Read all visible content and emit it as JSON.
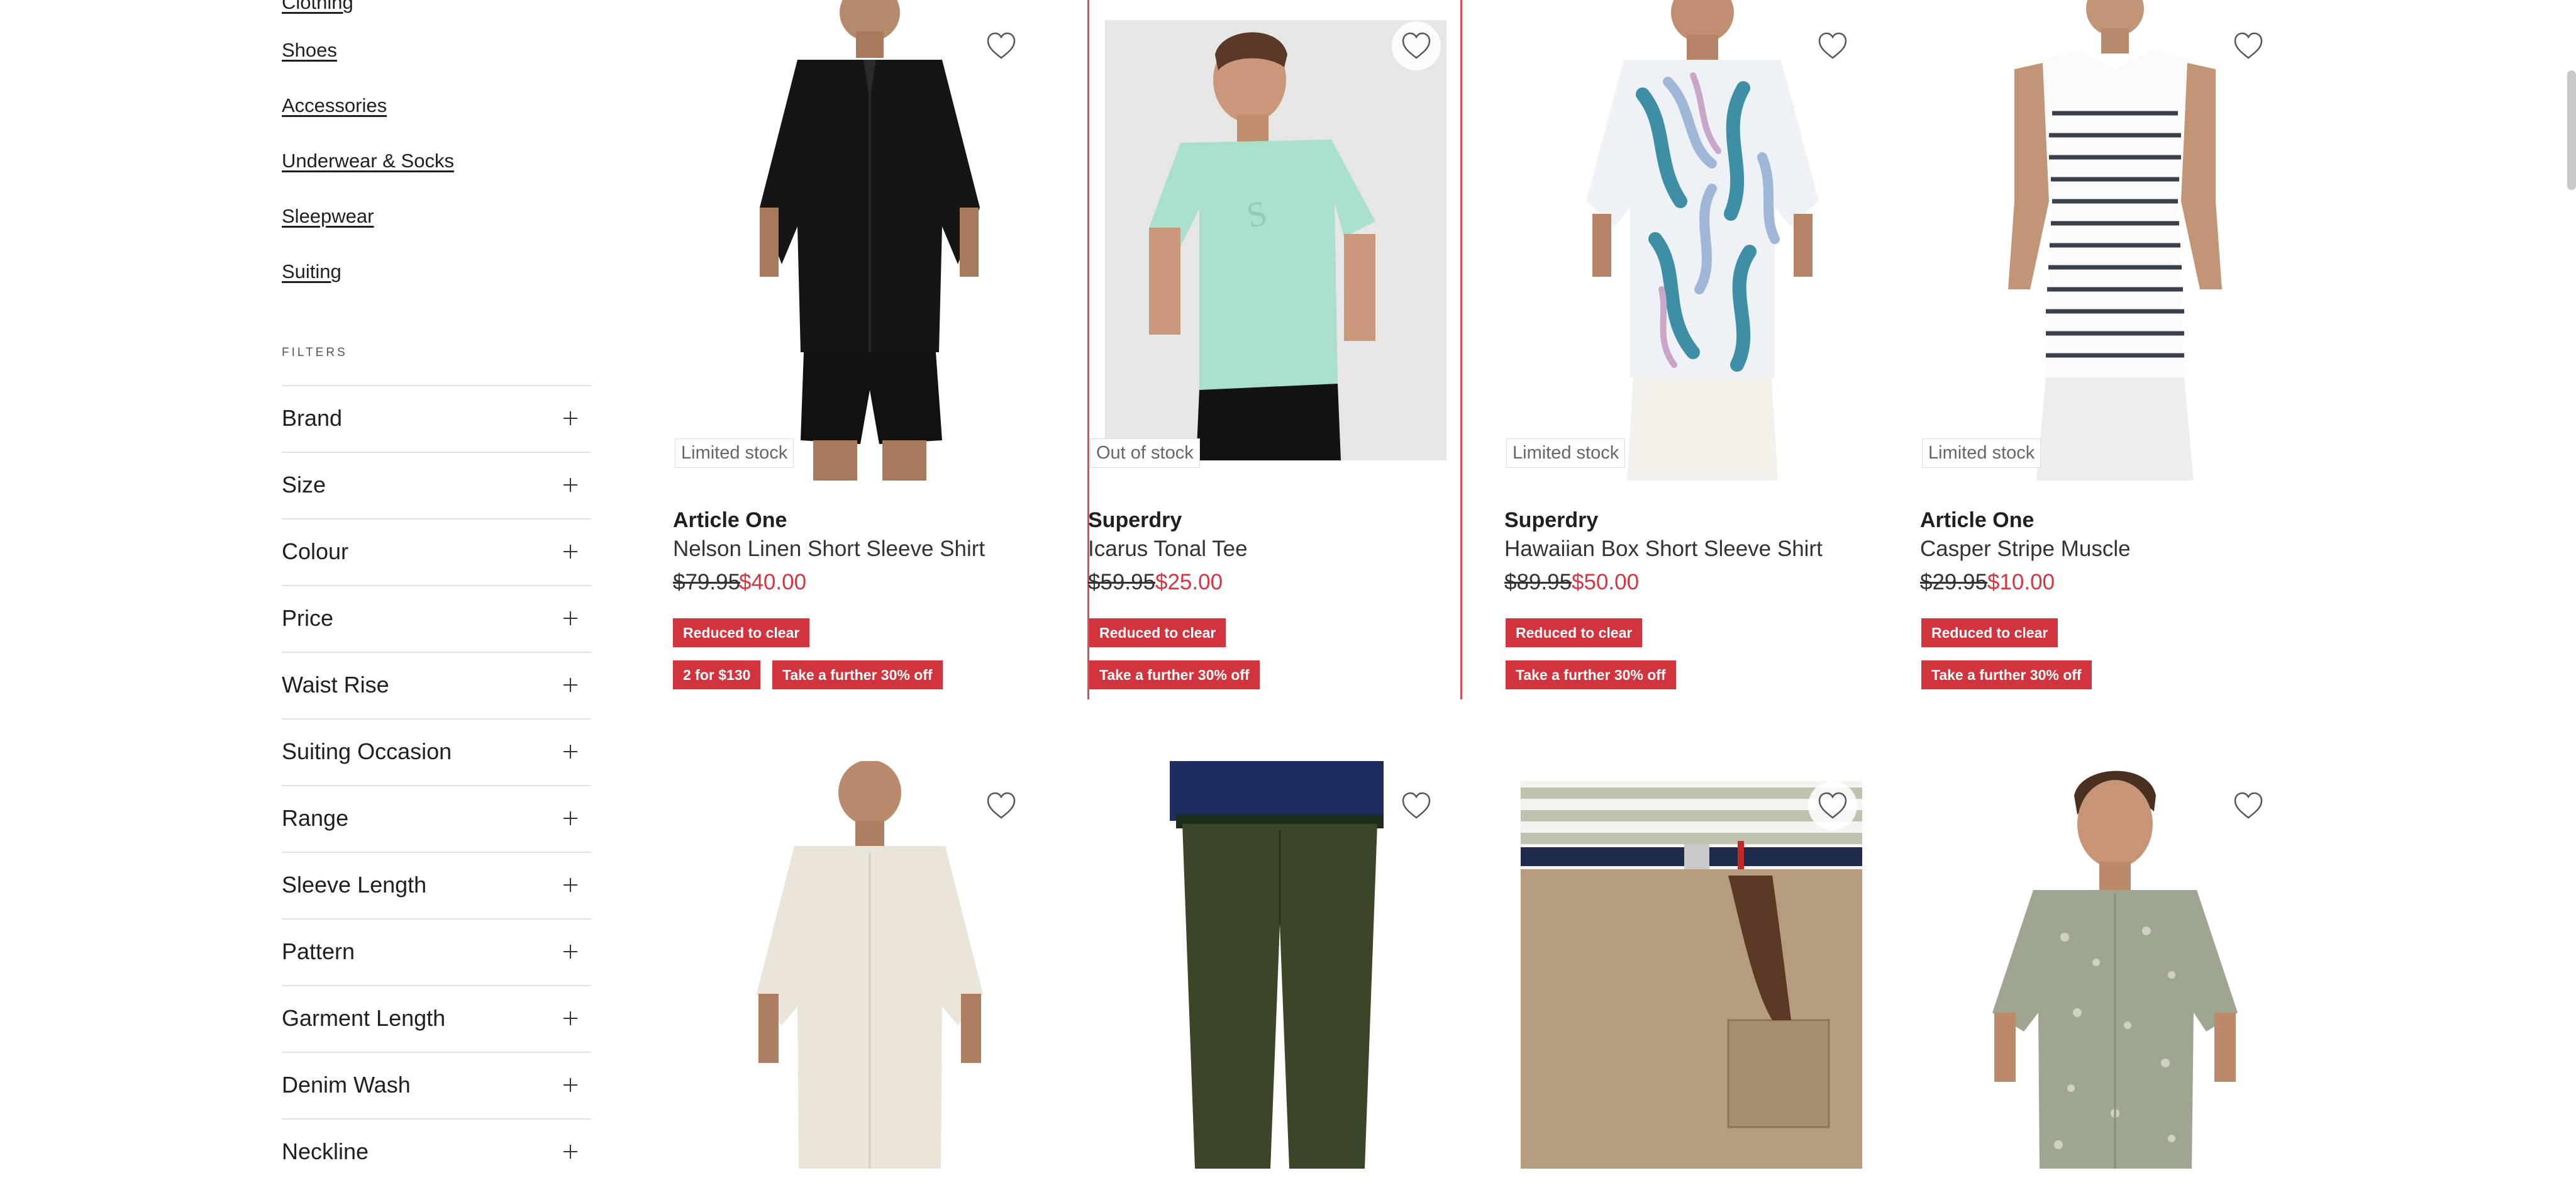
{
  "sidebar": {
    "categories": [
      "Clothing",
      "Shoes",
      "Accessories",
      "Underwear & Socks",
      "Sleepwear",
      "Suiting"
    ],
    "filters_heading": "FILTERS",
    "filters": [
      "Brand",
      "Size",
      "Colour",
      "Price",
      "Waist Rise",
      "Suiting Occasion",
      "Range",
      "Sleeve Length",
      "Pattern",
      "Garment Length",
      "Denim Wash",
      "Neckline"
    ]
  },
  "products": [
    {
      "stock": "Limited stock",
      "brand": "Article One",
      "name": "Nelson Linen Short Sleeve Shirt",
      "was": "$79.95",
      "now": "$40.00",
      "promo_1": "Reduced to clear",
      "promo_2": "2 for $130",
      "promo_3": "Take a further 30% off",
      "image_icon": "black-linen-shirt-image"
    },
    {
      "stock": "Out of stock",
      "brand": "Superdry",
      "name": "Icarus Tonal Tee",
      "was": "$59.95",
      "now": "$25.00",
      "promo_1": "Reduced to clear",
      "promo_2": "Take a further 30% off",
      "image_icon": "mint-tee-image"
    },
    {
      "stock": "Limited stock",
      "brand": "Superdry",
      "name": "Hawaiian Box Short Sleeve Shirt",
      "was": "$89.95",
      "now": "$50.00",
      "promo_1": "Reduced to clear",
      "promo_2": "Take a further 30% off",
      "image_icon": "hawaiian-shirt-image"
    },
    {
      "stock": "Limited stock",
      "brand": "Article One",
      "name": "Casper Stripe Muscle",
      "was": "$29.95",
      "now": "$10.00",
      "promo_1": "Reduced to clear",
      "promo_2": "Take a further 30% off",
      "image_icon": "stripe-muscle-image"
    }
  ],
  "colors": {
    "promo_red": "#d1343c",
    "sale_price": "#d6363f",
    "focus_outline": "#e24b4f"
  }
}
